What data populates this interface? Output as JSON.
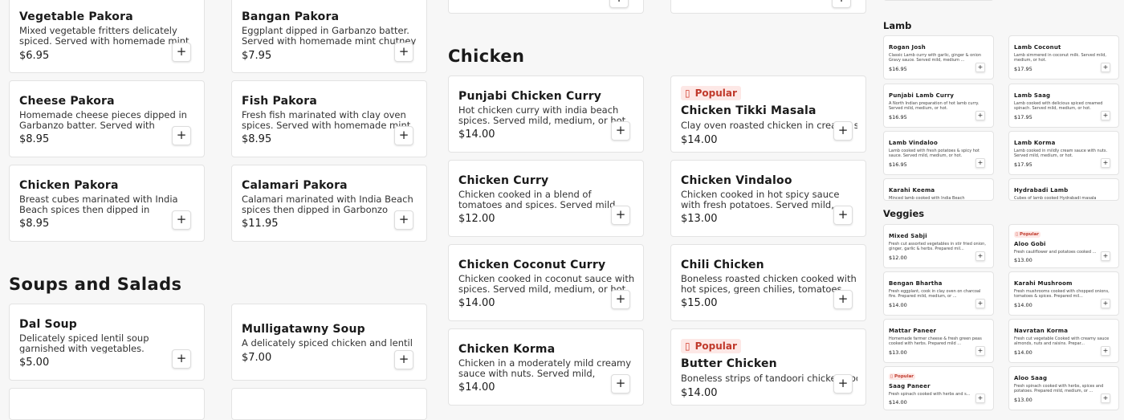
{
  "add_symbol": "+",
  "badge_label": "Popular",
  "badge_color": "#c0392b",
  "col1": {
    "items": [
      {
        "name": "Vegetable Pakora",
        "desc": "Mixed vegetable fritters delicately spiced. Served with homemade mint chutney and ...",
        "price": "$6.95"
      },
      {
        "name": "Cheese Pakora",
        "desc": "Homemade cheese pieces dipped in Garbanzo batter. Served with homemade ...",
        "price": "$8.95"
      },
      {
        "name": "Chicken Pakora",
        "desc": "Breast cubes marinated with India Beach spices then dipped in Garbonzo batter.",
        "price": "$8.95"
      }
    ]
  },
  "col2": {
    "items": [
      {
        "name": "Bangan Pakora",
        "desc": "Eggplant dipped in Garbanzo batter. Served with homemade mint chutney and hot & ...",
        "price": "$7.95"
      },
      {
        "name": "Fish Pakora",
        "desc": "Fresh fish marinated with clay oven spices. Served with homemade mint chutney and ...",
        "price": "$8.95"
      },
      {
        "name": "Calamari Pakora",
        "desc": "Calamari marinated with India Beach spices then dipped in Garbonzo batter. Served ...",
        "price": "$11.95"
      }
    ]
  },
  "soups": {
    "title": "Soups and Salads",
    "items": [
      {
        "name": "Dal Soup",
        "desc": "Delicately spiced lentil soup garnished with vegetables.",
        "price": "$5.00"
      },
      {
        "name": "Mulligatawny Soup",
        "desc": "A delicately spiced chicken and lentil soup.",
        "price": "$7.00"
      }
    ]
  },
  "chicken": {
    "title": "Chicken",
    "left": [
      {
        "name": "Punjabi Chicken Curry",
        "desc": "Hot chicken curry with india beach spices. Served mild, medium, or hot.",
        "price": "$14.00"
      },
      {
        "name": "Chicken Curry",
        "desc": "Chicken cooked in a blend of tomatoes and spices. Served mild, medium, or hot.",
        "price": "$12.00"
      },
      {
        "name": "Chicken Coconut Curry",
        "desc": "Chicken cooked in coconut sauce with spices. Served mild, medium, or hot.",
        "price": "$14.00"
      },
      {
        "name": "Chicken Korma",
        "desc": "Chicken in a moderately mild creamy sauce with nuts. Served mild, medium, or hot.",
        "price": "$14.00"
      }
    ],
    "right": [
      {
        "name": "Chicken Tikki Masala",
        "desc": "Clay oven roasted chicken in creamy sauce.",
        "price": "$14.00",
        "popular": true
      },
      {
        "name": "Chicken Vindaloo",
        "desc": "Chicken cooked in hot spicy sauce with fresh potatoes. Served mild, medium, or ...",
        "price": "$13.00"
      },
      {
        "name": "Chili Chicken",
        "desc": "Boneless roasted chicken cooked with hot spices, green chilies, tomatoes, vinigar a...",
        "price": "$15.00"
      },
      {
        "name": "Butter Chicken",
        "desc": "Boneless strips of tandoori chicken cooked ...",
        "price": "$14.00",
        "popular": true
      }
    ]
  },
  "lamb": {
    "title": "Lamb",
    "items": [
      {
        "name": "Rogan Josh",
        "desc": "Classic Lamb curry with garlic, ginger & onion Gravy sauce. Served mild, medium ...",
        "price": "$16.95"
      },
      {
        "name": "Lamb Coconut",
        "desc": "Lamb simmered in coconut milk. Served mild, medium, or hot.",
        "price": "$17.95"
      },
      {
        "name": "Punjabi Lamb Curry",
        "desc": "A North Indian preparation of hot lamb curry. Served mild, medium, or hot.",
        "price": "$16.95"
      },
      {
        "name": "Lamb Saag",
        "desc": "Lamb cooked with delicious spiced creamed spinach. Served mild, medium, or hot.",
        "price": "$17.95"
      },
      {
        "name": "Lamb Vindaloo",
        "desc": "Lamb cooked with fresh potatoes & spicy hot sauce. Served mild, medium, or hot.",
        "price": "$16.95"
      },
      {
        "name": "Lamb Korma",
        "desc": "Lamb cooked in mildly cream sauce with nuts. Served mild, medium, or hot.",
        "price": "$17.95"
      },
      {
        "name": "Karahi Keema",
        "desc": "Minced lamb cooked with India Beach",
        "price": ""
      },
      {
        "name": "Hydrabadi Lamb",
        "desc": "Cubes of lamb cooked Hydrabadi masala",
        "price": ""
      }
    ]
  },
  "veggies": {
    "title": "Veggies",
    "items": [
      {
        "name": "Mixed Sabji",
        "desc": "Fresh cut assorted vegetables in stir fried onion, ginger, garlic & herbs. Prepared mil...",
        "price": "$12.00"
      },
      {
        "name": "Aloo Gobi",
        "desc": "Fresh cauliflower and potatoes cooked ...",
        "price": "$13.00",
        "popular": true
      },
      {
        "name": "Bengan Bhartha",
        "desc": "Fresh eggplant, cook in clay oven on charcoal fire. Prepared mild, medium, or ...",
        "price": "$14.00"
      },
      {
        "name": "Karahi Mushroom",
        "desc": "Fresh mushrooms cooked with chopped onions, tomatoes & spices. Prepared mil...",
        "price": "$14.00"
      },
      {
        "name": "Mattar Paneer",
        "desc": "Homemade farmer cheese & fresh green peas cooked with herbs. Prepared mild ...",
        "price": "$13.00"
      },
      {
        "name": "Navratan Korma",
        "desc": "Fresh cut vegetable Cooked with creamy sauce almonds, nuts and raisins. Prepar...",
        "price": "$14.00"
      },
      {
        "name": "Saag Paneer",
        "desc": "Fresh spinach cooked with herbs and s...",
        "price": "$14.00",
        "popular": true
      },
      {
        "name": "Aloo Saag",
        "desc": "Fresh spinach cooked with herbs, spices and potatoes. Prepared mild, medium, or ...",
        "price": "$13.00"
      }
    ]
  }
}
